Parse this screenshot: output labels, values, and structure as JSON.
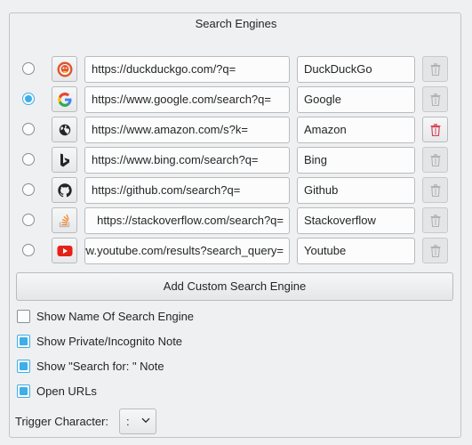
{
  "group": {
    "title": "Search Engines"
  },
  "engines": [
    {
      "url": "https://duckduckgo.com/?q=",
      "name": "DuckDuckGo",
      "selected": false,
      "icon": "duckduckgo-icon",
      "delete_enabled": false
    },
    {
      "url": "https://www.google.com/search?q=",
      "name": "Google",
      "selected": true,
      "icon": "google-icon",
      "delete_enabled": false
    },
    {
      "url": "https://www.amazon.com/s?k=",
      "name": "Amazon",
      "selected": false,
      "icon": "globe-icon",
      "delete_enabled": true
    },
    {
      "url": "https://www.bing.com/search?q=",
      "name": "Bing",
      "selected": false,
      "icon": "bing-icon",
      "delete_enabled": false
    },
    {
      "url": "https://github.com/search?q=",
      "name": "Github",
      "selected": false,
      "icon": "github-icon",
      "delete_enabled": false
    },
    {
      "url": "https://stackoverflow.com/search?q=",
      "name": "Stackoverflow",
      "selected": false,
      "icon": "stackoverflow-icon",
      "delete_enabled": false
    },
    {
      "url": "https://www.youtube.com/results?search_query=",
      "name": "Youtube",
      "selected": false,
      "icon": "youtube-icon",
      "delete_enabled": false
    }
  ],
  "add_button": {
    "label": "Add Custom Search Engine"
  },
  "options": [
    {
      "label": "Show Name Of Search Engine",
      "checked": false
    },
    {
      "label": "Show Private/Incognito Note",
      "checked": true
    },
    {
      "label": "Show \"Search for: \" Note",
      "checked": true
    },
    {
      "label": "Open URLs",
      "checked": true
    }
  ],
  "trigger": {
    "label": "Trigger Character:",
    "value": ":"
  },
  "colors": {
    "accent": "#3daee9",
    "delete_active": "#da4453",
    "delete_disabled": "#b0b3b6"
  }
}
